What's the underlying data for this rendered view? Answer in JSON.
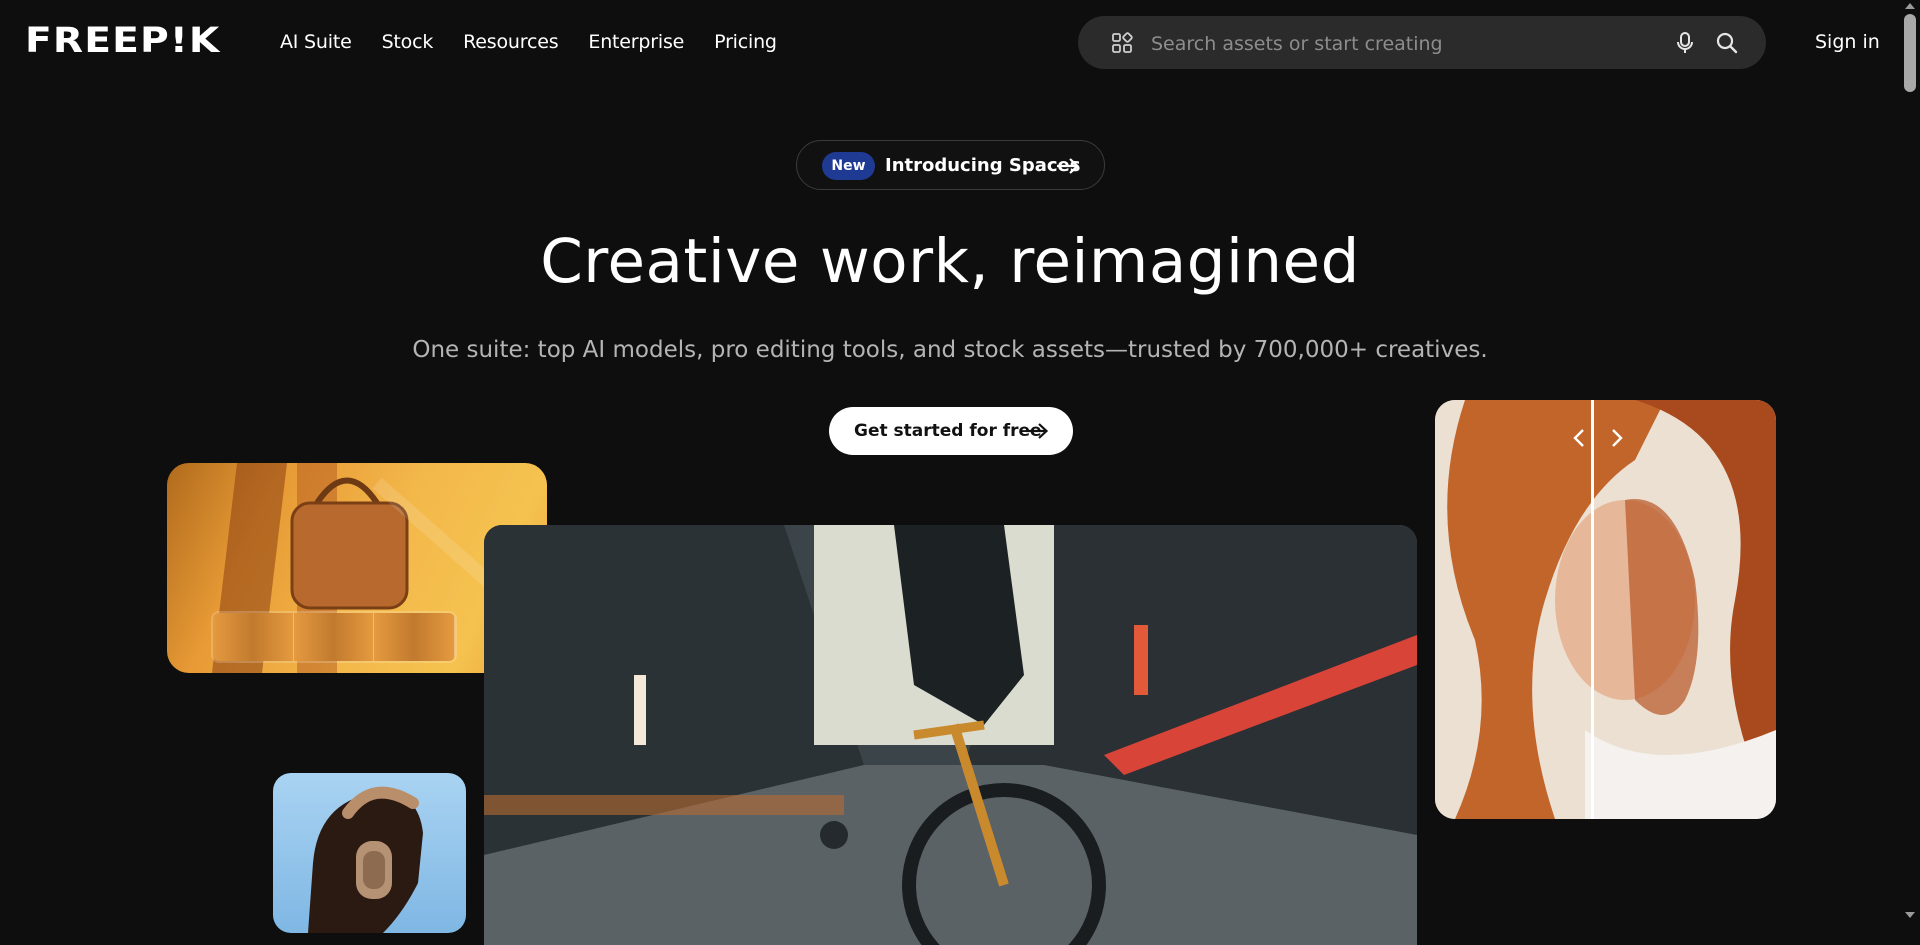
{
  "header": {
    "logo_text": "FREEP!K",
    "nav": [
      "AI Suite",
      "Stock",
      "Resources",
      "Enterprise",
      "Pricing"
    ],
    "search_placeholder": "Search assets or start creating",
    "signin_label": "Sign in"
  },
  "hero": {
    "badge": "New",
    "announcement": "Introducing Spaces",
    "headline": "Creative work, reimagined",
    "subheadline": "One suite: top AI models, pro editing tools, and stock assets—trusted by 700,000+ creatives.",
    "cta_label": "Get started for free"
  },
  "colors": {
    "background": "#0e0e0e",
    "search_bg": "#2b2b2b",
    "badge_bg": "#1f3a93",
    "cta_bg": "#ffffff"
  },
  "icons": [
    "grid-icon",
    "microphone-icon",
    "search-icon",
    "arrow-right-icon",
    "chevron-left-icon",
    "chevron-right-icon"
  ]
}
